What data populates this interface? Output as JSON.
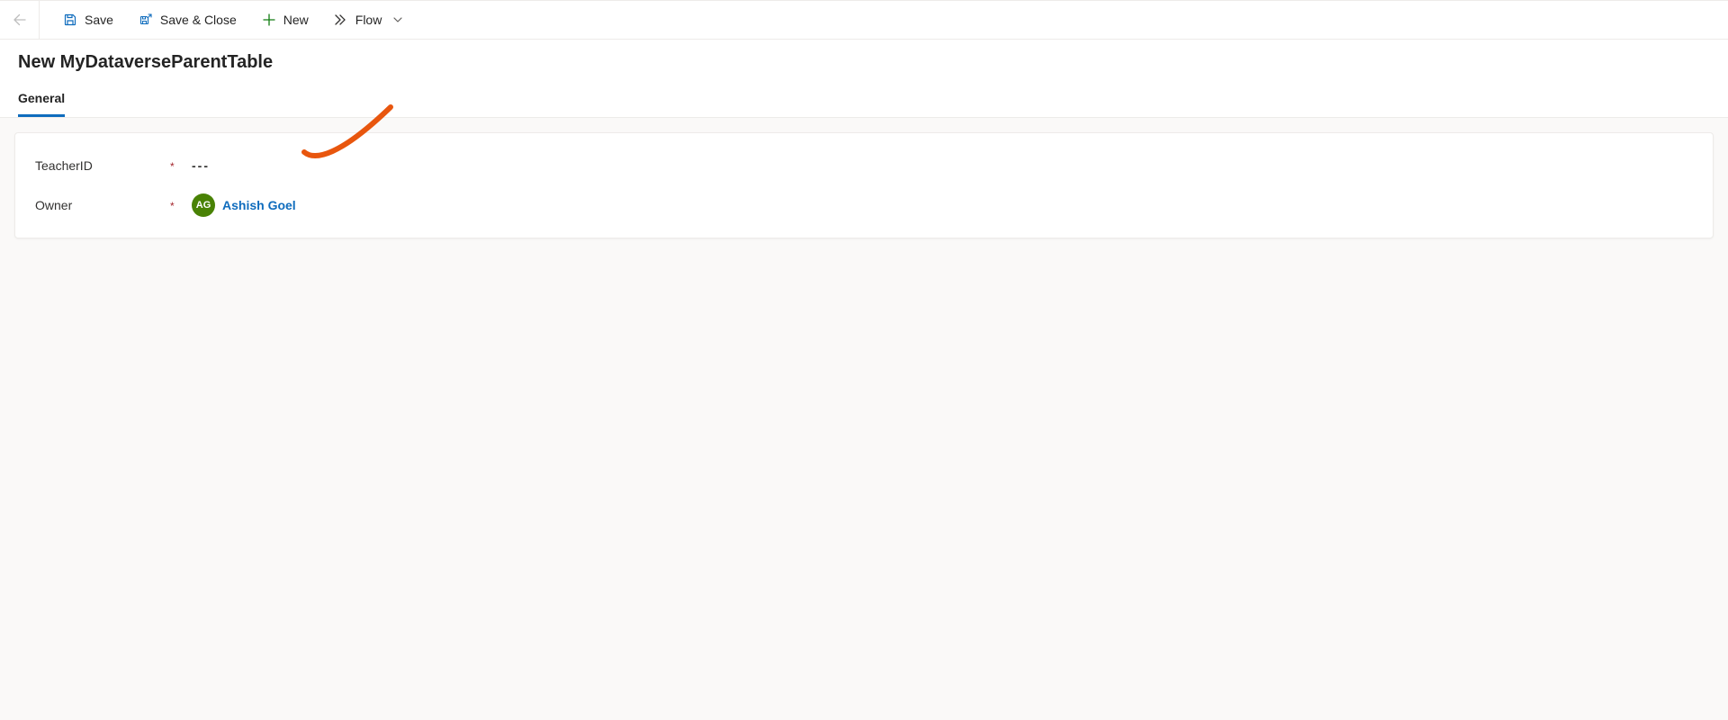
{
  "toolbar": {
    "save_label": "Save",
    "save_close_label": "Save & Close",
    "new_label": "New",
    "flow_label": "Flow"
  },
  "header": {
    "title": "New MyDataverseParentTable"
  },
  "tabs": [
    {
      "label": "General",
      "active": true
    }
  ],
  "form": {
    "fields": [
      {
        "label": "TeacherID",
        "required": true,
        "value": "---",
        "type": "text"
      },
      {
        "label": "Owner",
        "required": true,
        "owner_name": "Ashish Goel",
        "owner_initials": "AG",
        "type": "owner"
      }
    ],
    "required_mark": "*"
  }
}
